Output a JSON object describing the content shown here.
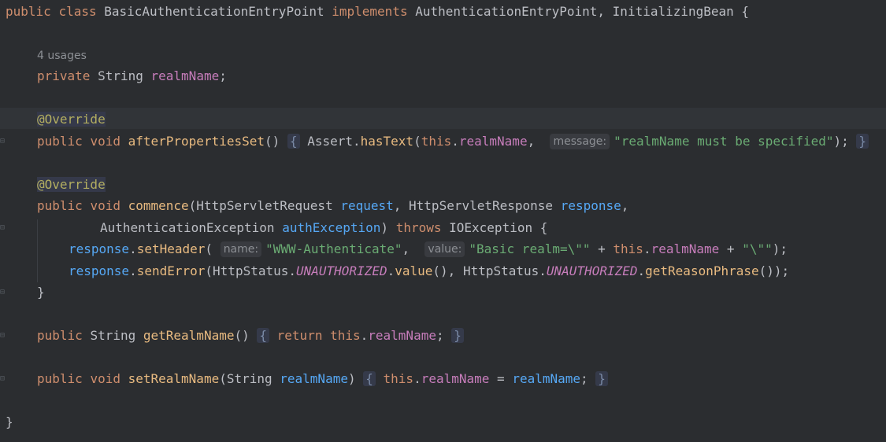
{
  "editor": {
    "usages": "4 usages",
    "lines": {
      "class_decl": {
        "kw1": "public",
        "kw2": "class",
        "name": "BasicAuthenticationEntryPoint",
        "kw3": "implements",
        "rest": "AuthenticationEntryPoint, InitializingBean {"
      },
      "field": {
        "kw": "private",
        "type": "String",
        "name": "realmName",
        "semi": ";"
      },
      "override1": "@Override",
      "afterprops": {
        "kw1": "public",
        "kw2": "void",
        "name": "afterPropertiesSet",
        "parens": "()",
        "open": "{",
        "cls": "Assert",
        "dot": ".",
        "method": "hasText",
        "p1": "(",
        "this": "this",
        "dot2": ".",
        "field": "realmName",
        "comma": ",",
        "hint": "message:",
        "str": "\"realmName must be specified\"",
        "end": ");",
        "close": "}"
      },
      "override2": "@Override",
      "commence1": {
        "kw1": "public",
        "kw2": "void",
        "name": "commence",
        "p1": "(HttpServletRequest ",
        "param1": "request",
        "mid": ", HttpServletResponse ",
        "param2": "response",
        "comma": ","
      },
      "commence2": {
        "type": "AuthenticationException ",
        "param": "authException",
        "close": ")",
        "kw": "throws",
        "rest": " IOException {"
      },
      "setheader": {
        "var": "response",
        "dot": ".",
        "method": "setHeader",
        "p1": "(",
        "hint1": "name:",
        "str1": "\"WWW-Authenticate\"",
        "comma": ", ",
        "hint2": "value:",
        "str2": "\"Basic realm=\\\"\"",
        "plus1": " + ",
        "this": "this",
        "dot2": ".",
        "field": "realmName",
        "plus2": " + ",
        "str3": "\"\\\"\"",
        "end": ");"
      },
      "senderror": {
        "var": "response",
        "dot": ".",
        "method": "sendError",
        "p1": "(HttpStatus.",
        "const1": "UNAUTHORIZED",
        "dot2": ".",
        "m2": "value",
        "mid": "(), HttpStatus.",
        "const2": "UNAUTHORIZED",
        "dot3": ".",
        "m3": "getReasonPhrase",
        "end": "());"
      },
      "close_method": "}",
      "getter": {
        "kw": "public",
        "type": "String",
        "name": "getRealmName",
        "parens": "()",
        "open": "{",
        "ret": "return",
        "this": "this",
        "dot": ".",
        "field": "realmName",
        "semi": ";",
        "close": "}"
      },
      "setter": {
        "kw1": "public",
        "kw2": "void",
        "name": "setRealmName",
        "p1": "(String ",
        "param": "realmName",
        "p2": ")",
        "open": "{",
        "this": "this",
        "dot": ".",
        "field": "realmName",
        "eq": " = ",
        "param2": "realmName",
        "semi": ";",
        "close": "}"
      },
      "close_class": "}"
    }
  }
}
